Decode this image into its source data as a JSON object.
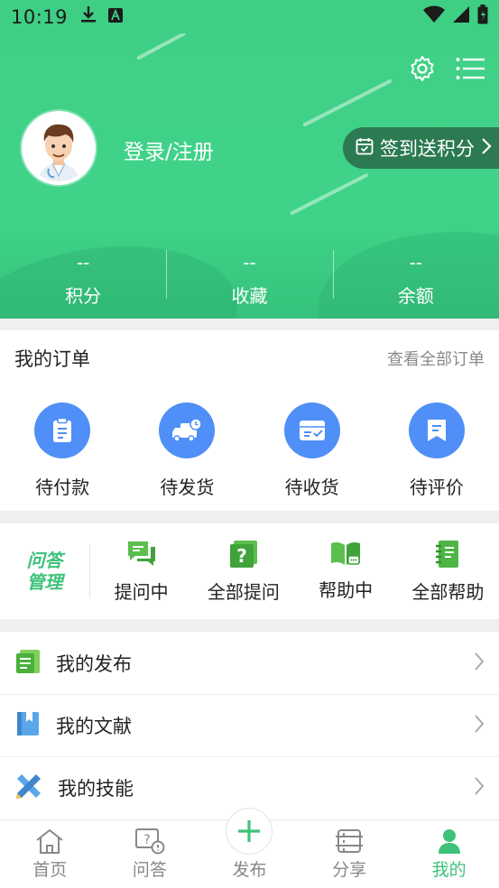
{
  "status_bar": {
    "time": "10:19"
  },
  "profile": {
    "login_label": "登录/注册",
    "signin_label": "签到送积分",
    "stats": [
      {
        "value": "--",
        "label": "积分"
      },
      {
        "value": "--",
        "label": "收藏"
      },
      {
        "value": "--",
        "label": "余额"
      }
    ]
  },
  "orders": {
    "title": "我的订单",
    "view_all": "查看全部订单",
    "items": [
      {
        "label": "待付款",
        "icon": "clipboard-icon"
      },
      {
        "label": "待发货",
        "icon": "delivery-truck-icon"
      },
      {
        "label": "待收货",
        "icon": "inbox-check-icon"
      },
      {
        "label": "待评价",
        "icon": "comment-icon"
      }
    ]
  },
  "qa": {
    "logo_line1": "问答",
    "logo_line2": "管理",
    "items": [
      {
        "label": "提问中",
        "icon": "chat-bubbles-icon"
      },
      {
        "label": "全部提问",
        "icon": "question-card-icon"
      },
      {
        "label": "帮助中",
        "icon": "open-book-icon"
      },
      {
        "label": "全部帮助",
        "icon": "notebook-icon"
      }
    ]
  },
  "menu": [
    {
      "label": "我的发布",
      "icon": "publish-list-icon"
    },
    {
      "label": "我的文献",
      "icon": "bookmark-book-icon"
    },
    {
      "label": "我的技能",
      "icon": "pencil-ruler-icon"
    }
  ],
  "tabs": [
    {
      "label": "首页",
      "icon": "home-icon",
      "active": false
    },
    {
      "label": "问答",
      "icon": "qa-icon",
      "active": false
    },
    {
      "label": "发布",
      "icon": "plus-icon",
      "active": false
    },
    {
      "label": "分享",
      "icon": "share-stack-icon",
      "active": false
    },
    {
      "label": "我的",
      "icon": "person-icon",
      "active": true
    }
  ],
  "colors": {
    "primary_green": "#3ecf85",
    "accent_blue": "#4f8ff7",
    "active_tab": "#3ec27b"
  }
}
